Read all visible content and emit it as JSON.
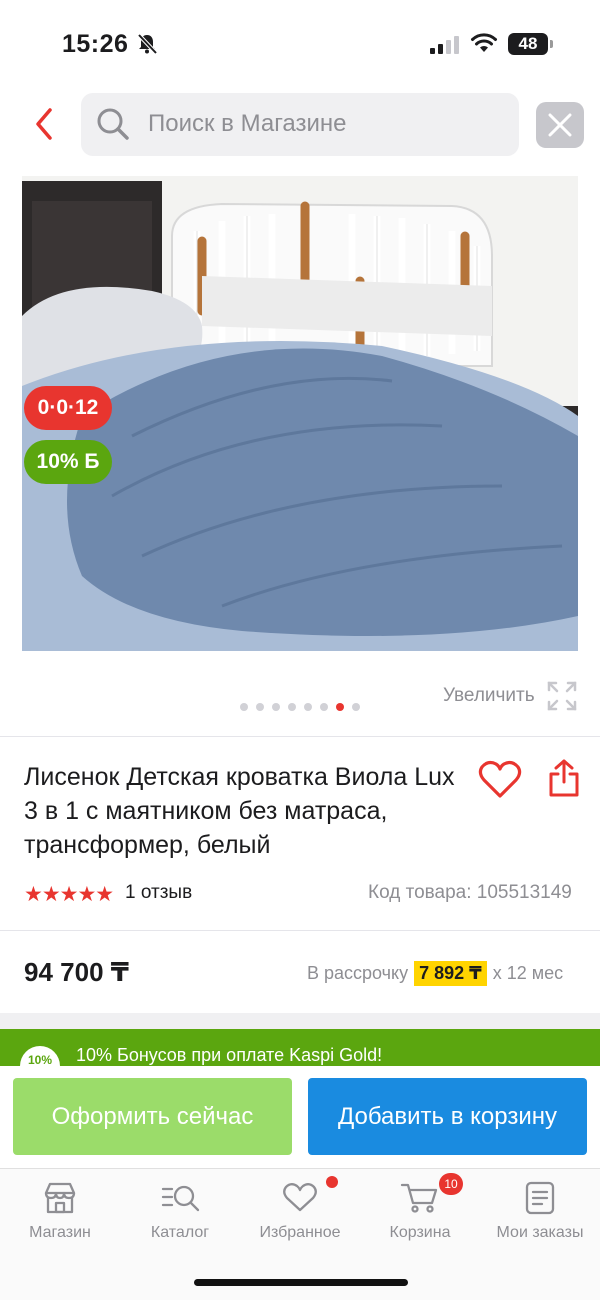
{
  "status": {
    "time": "15:26",
    "battery": "48"
  },
  "search": {
    "placeholder": "Поиск в Магазине"
  },
  "gallery": {
    "installment_badge": "0·0·12",
    "bonus_badge": "10% Б",
    "zoom_label": "Увеличить",
    "image_count": 8,
    "active_index": 6
  },
  "product": {
    "title": "Лисенок Детская кроватка Виола Lux 3 в 1 с маятником без матраса, трансформер, белый",
    "rating": 5,
    "stars": "★★★★★",
    "reviews": "1 отзыв",
    "code": "Код товара: 105513149",
    "price": "94 700 ₸",
    "installment_prefix": "В рассрочку",
    "installment_amount": "7 892 ₸",
    "installment_suffix": "x 12 мес"
  },
  "bonus": {
    "circle": "10%",
    "text": "10% Бонусов при оплате Kaspi Gold!"
  },
  "actions": {
    "buy_now": "Оформить сейчас",
    "add_to_cart": "Добавить в корзину"
  },
  "tabs": [
    {
      "label": "Магазин",
      "icon": "store-icon"
    },
    {
      "label": "Каталог",
      "icon": "catalog-icon"
    },
    {
      "label": "Избранное",
      "icon": "heart-icon"
    },
    {
      "label": "Корзина",
      "icon": "cart-icon",
      "badge": "10"
    },
    {
      "label": "Мои заказы",
      "icon": "orders-icon"
    }
  ],
  "colors": {
    "accent_red": "#e8352f",
    "bonus_green": "#5ba60f",
    "buy_now_green": "#9bdc6a",
    "cart_blue": "#1a8be0",
    "installment_yellow": "#ffd400"
  }
}
